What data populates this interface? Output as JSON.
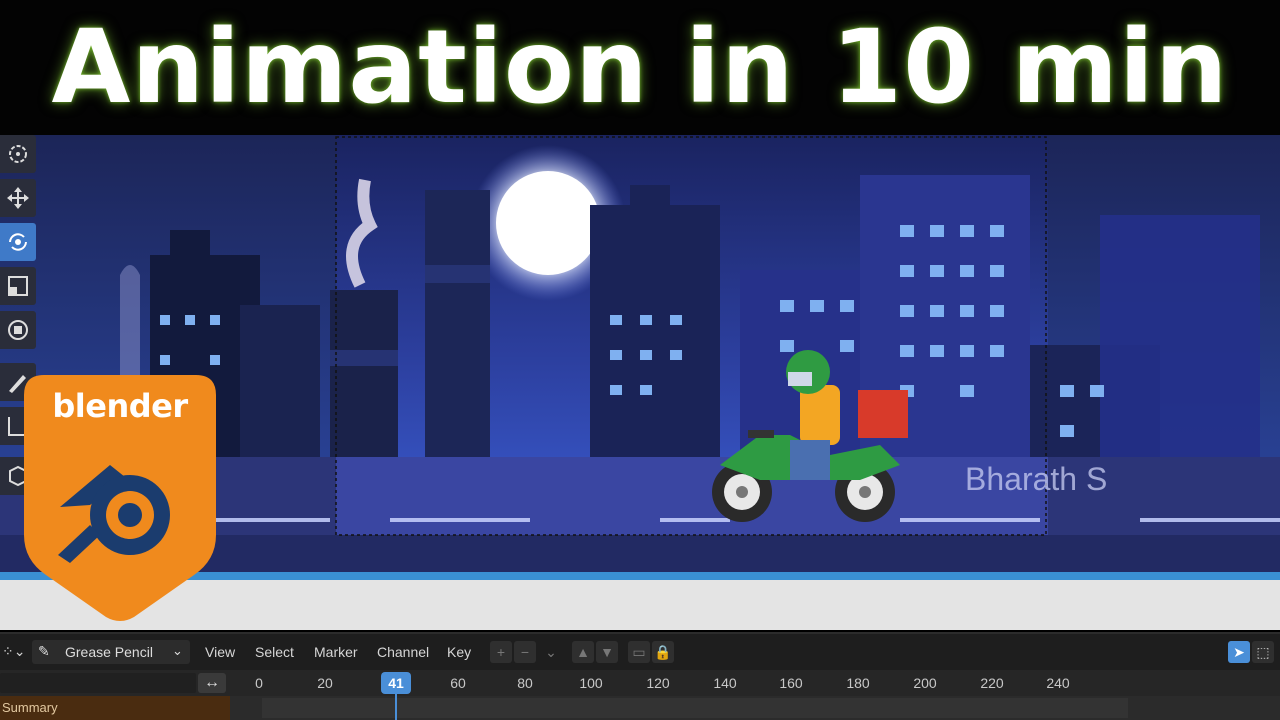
{
  "title": "Animation in 10 min",
  "viewport": {
    "watermark": "Bharath S"
  },
  "logo": {
    "text": "blender"
  },
  "toolbar": {
    "tools": [
      {
        "name": "cursor-icon"
      },
      {
        "name": "move-icon"
      },
      {
        "name": "rotate-icon",
        "active": true
      },
      {
        "name": "scale-icon"
      },
      {
        "name": "transform-icon"
      },
      {
        "name": "annotate-icon"
      },
      {
        "name": "measure-icon"
      },
      {
        "name": "add-cube-icon"
      }
    ]
  },
  "timeline": {
    "editor_mode": "Grease Pencil",
    "menus": [
      "View",
      "Select",
      "Marker",
      "Channel",
      "Key"
    ],
    "ruler_ticks": [
      "0",
      "20",
      "41",
      "60",
      "80",
      "100",
      "120",
      "140",
      "160",
      "180",
      "200",
      "220",
      "240"
    ],
    "current_frame": "41",
    "channel_summary": "Summary"
  }
}
